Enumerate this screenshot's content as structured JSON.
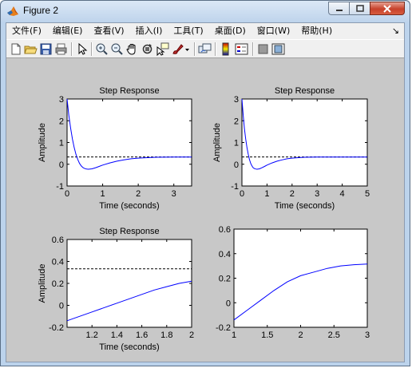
{
  "window": {
    "title": "Figure 2"
  },
  "menubar": {
    "items": [
      {
        "label": "文件(F)"
      },
      {
        "label": "编辑(E)"
      },
      {
        "label": "查看(V)"
      },
      {
        "label": "插入(I)"
      },
      {
        "label": "工具(T)"
      },
      {
        "label": "桌面(D)"
      },
      {
        "label": "窗口(W)"
      },
      {
        "label": "帮助(H)"
      }
    ],
    "overflow_arrow": "↘"
  },
  "toolbar": {
    "icons": [
      "new-figure-icon",
      "open-file-icon",
      "save-icon",
      "print-icon",
      "edit-plot-arrow-icon",
      "zoom-in-icon",
      "zoom-out-icon",
      "pan-hand-icon",
      "rotate-3d-icon",
      "data-cursor-icon",
      "brush-icon",
      "brush-dropdown-icon",
      "link-plot-icon",
      "insert-colorbar-icon",
      "insert-legend-icon",
      "hide-plot-tools-icon",
      "show-plot-tools-icon"
    ]
  },
  "colors": {
    "curve": "#0000ff",
    "axes_bg": "#ffffff",
    "figure_bg": "#c8c8c8",
    "steady_line": "#000000"
  },
  "chart_data": [
    {
      "type": "line",
      "title": "Step Response",
      "xlabel": "Time (seconds)",
      "ylabel": "Amplitude",
      "xlim": [
        0,
        3.5
      ],
      "ylim": [
        -1,
        3
      ],
      "xticks": [
        "0",
        "1",
        "2",
        "3"
      ],
      "yticks": [
        "-1",
        "0",
        "1",
        "2",
        "3"
      ],
      "steady_state": 0.333,
      "series": [
        {
          "x": [
            0,
            0.05,
            0.1,
            0.15,
            0.2,
            0.25,
            0.3,
            0.35,
            0.4,
            0.45,
            0.5,
            0.55,
            0.6,
            0.65,
            0.7,
            0.8,
            0.9,
            1.0,
            1.2,
            1.4,
            1.6,
            1.8,
            2.0,
            2.2,
            2.5,
            3.0,
            3.5
          ],
          "y": [
            3.0,
            2.25,
            1.65,
            1.16,
            0.77,
            0.46,
            0.22,
            0.04,
            -0.08,
            -0.16,
            -0.2,
            -0.22,
            -0.23,
            -0.22,
            -0.21,
            -0.16,
            -0.1,
            -0.04,
            0.06,
            0.14,
            0.2,
            0.25,
            0.28,
            0.3,
            0.32,
            0.33,
            0.333
          ]
        }
      ]
    },
    {
      "type": "line",
      "title": "Step Response",
      "xlabel": "Time (seconds)",
      "ylabel": "Amplitude",
      "xlim": [
        0,
        5
      ],
      "ylim": [
        -1,
        3
      ],
      "xticks": [
        "0",
        "1",
        "2",
        "3",
        "4",
        "5"
      ],
      "yticks": [
        "-1",
        "0",
        "1",
        "2",
        "3"
      ],
      "steady_state": 0.333,
      "series": [
        {
          "x": [
            0,
            0.05,
            0.1,
            0.15,
            0.2,
            0.25,
            0.3,
            0.35,
            0.4,
            0.45,
            0.5,
            0.55,
            0.6,
            0.65,
            0.7,
            0.8,
            0.9,
            1.0,
            1.2,
            1.4,
            1.6,
            1.8,
            2.0,
            2.2,
            2.5,
            3.0,
            4.0,
            5.0
          ],
          "y": [
            3.0,
            2.25,
            1.65,
            1.16,
            0.77,
            0.46,
            0.22,
            0.04,
            -0.08,
            -0.16,
            -0.2,
            -0.22,
            -0.23,
            -0.22,
            -0.21,
            -0.16,
            -0.1,
            -0.04,
            0.06,
            0.14,
            0.2,
            0.25,
            0.28,
            0.3,
            0.32,
            0.33,
            0.333,
            0.333
          ]
        }
      ]
    },
    {
      "type": "line",
      "title": "Step Response",
      "xlabel": "Time (seconds)",
      "ylabel": "Amplitude",
      "xlim": [
        1,
        2
      ],
      "ylim": [
        -0.2,
        0.6
      ],
      "xticks": [
        "1.2",
        "1.4",
        "1.6",
        "1.8",
        "2"
      ],
      "yticks": [
        "-0.2",
        "0",
        "0.2",
        "0.4",
        "0.6"
      ],
      "steady_state": 0.333,
      "series": [
        {
          "x": [
            1.0,
            1.1,
            1.2,
            1.3,
            1.4,
            1.5,
            1.6,
            1.7,
            1.8,
            1.9,
            2.0
          ],
          "y": [
            -0.14,
            -0.1,
            -0.06,
            -0.02,
            0.02,
            0.06,
            0.1,
            0.14,
            0.17,
            0.2,
            0.22
          ]
        }
      ]
    },
    {
      "type": "line",
      "title": "",
      "xlabel": "",
      "ylabel": "",
      "xlim": [
        1,
        3
      ],
      "ylim": [
        -0.2,
        0.6
      ],
      "xticks": [
        "1",
        "1.5",
        "2",
        "2.5",
        "3"
      ],
      "yticks": [
        "-0.2",
        "0",
        "0.2",
        "0.4",
        "0.6"
      ],
      "series": [
        {
          "x": [
            1.0,
            1.2,
            1.4,
            1.6,
            1.8,
            2.0,
            2.2,
            2.4,
            2.6,
            2.8,
            3.0
          ],
          "y": [
            -0.14,
            -0.06,
            0.02,
            0.1,
            0.17,
            0.22,
            0.25,
            0.28,
            0.3,
            0.31,
            0.315
          ]
        }
      ]
    }
  ]
}
